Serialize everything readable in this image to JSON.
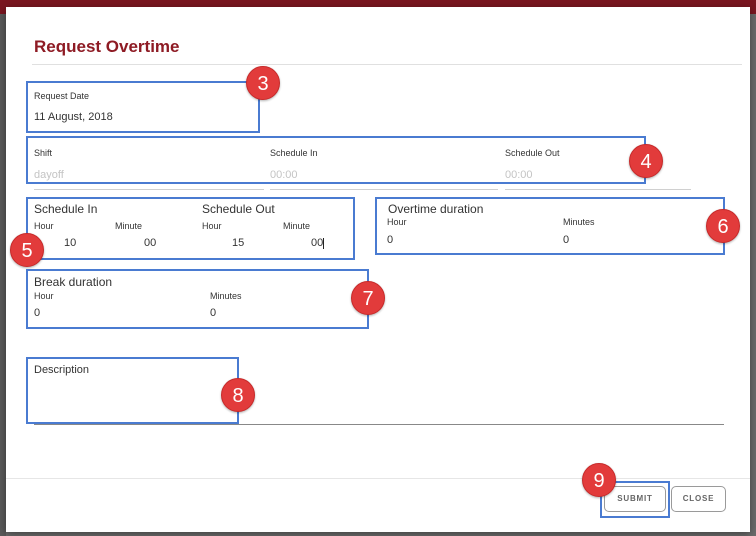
{
  "modal": {
    "title": "Request Overtime",
    "request_date": {
      "label": "Request Date",
      "value": "11 August, 2018"
    },
    "shift_row": {
      "shift": {
        "label": "Shift",
        "value": "dayoff"
      },
      "schedule_in": {
        "label": "Schedule In",
        "value": "00:00"
      },
      "schedule_out": {
        "label": "Schedule Out",
        "value": "00:00"
      }
    },
    "schedule": {
      "in_heading": "Schedule In",
      "out_heading": "Schedule Out",
      "in_hour": {
        "label": "Hour",
        "value": "10"
      },
      "in_minute": {
        "label": "Minute",
        "value": "00"
      },
      "out_hour": {
        "label": "Hour",
        "value": "15"
      },
      "out_minute": {
        "label": "Minute",
        "value": "00"
      }
    },
    "overtime": {
      "heading": "Overtime duration",
      "hour": {
        "label": "Hour",
        "value": "0"
      },
      "minutes": {
        "label": "Minutes",
        "value": "0"
      }
    },
    "break": {
      "heading": "Break duration",
      "hour": {
        "label": "Hour",
        "value": "0"
      },
      "minutes": {
        "label": "Minutes",
        "value": "0"
      }
    },
    "description": {
      "label": "Description",
      "value": ""
    },
    "buttons": {
      "submit": "SUBMIT",
      "close": "CLOSE"
    }
  },
  "annotations": [
    "3",
    "4",
    "5",
    "6",
    "7",
    "8",
    "9"
  ],
  "colors": {
    "title": "#8e1b24",
    "highlight": "#4a7bd1",
    "badge": "#e23b3b"
  }
}
